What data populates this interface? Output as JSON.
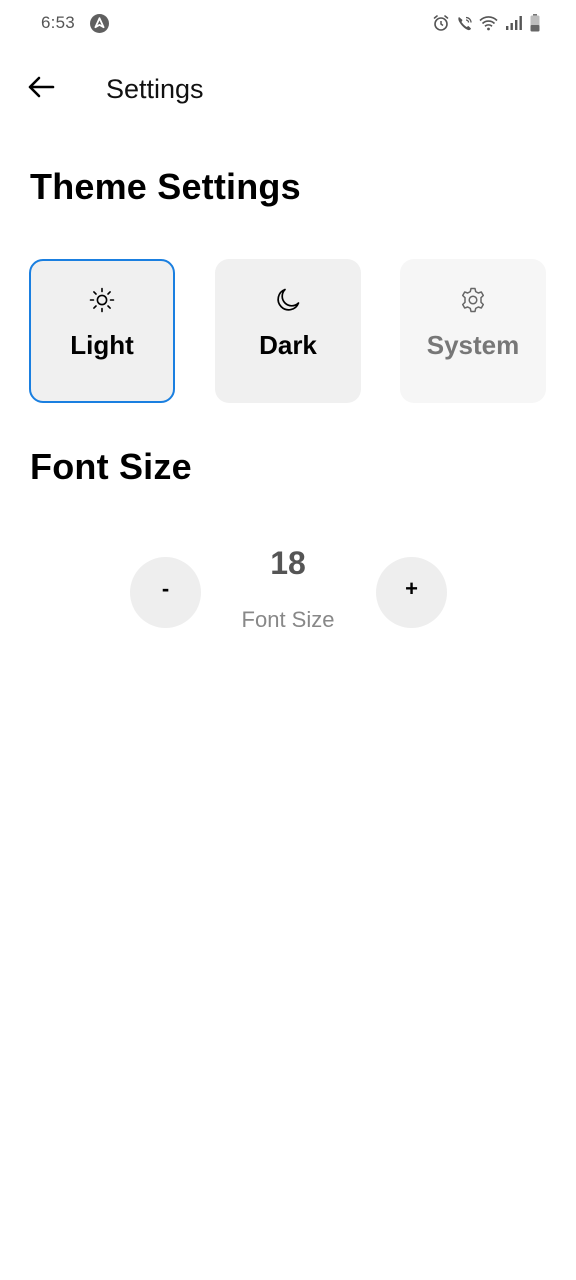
{
  "status_bar": {
    "time": "6:53",
    "app_icon": "navigation-icon",
    "icons": [
      "alarm-icon",
      "wifi-calling-icon",
      "wifi-icon",
      "signal-icon",
      "battery-icon"
    ]
  },
  "header": {
    "title": "Settings",
    "back_icon": "arrow-left-icon"
  },
  "theme": {
    "section_title": "Theme Settings",
    "selected": "Light",
    "accent_color": "#1a7fe0",
    "options": [
      {
        "label": "Light",
        "icon": "sun-icon"
      },
      {
        "label": "Dark",
        "icon": "moon-icon"
      },
      {
        "label": "System",
        "icon": "gear-icon"
      }
    ]
  },
  "font_size": {
    "section_title": "Font Size",
    "value": "18",
    "caption": "Font Size",
    "decrease_label": "-",
    "increase_label": "+"
  }
}
